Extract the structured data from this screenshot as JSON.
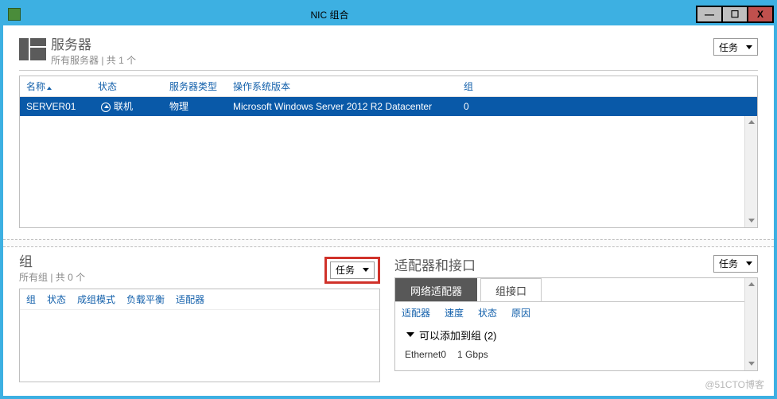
{
  "window": {
    "title": "NIC 组合",
    "min": "—",
    "max": "☐",
    "close": "X"
  },
  "servers": {
    "title": "服务器",
    "subtitle": "所有服务器 | 共 1 个",
    "task_label": "任务",
    "columns": {
      "name": "名称",
      "status": "状态",
      "type": "服务器类型",
      "os": "操作系统版本",
      "group": "组"
    },
    "row": {
      "name": "SERVER01",
      "status": "联机",
      "type": "物理",
      "os": "Microsoft Windows Server 2012 R2 Datacenter",
      "group": "0"
    }
  },
  "groups": {
    "title": "组",
    "subtitle": "所有组 | 共 0 个",
    "task_label": "任务",
    "columns": {
      "group": "组",
      "status": "状态",
      "mode": "成组模式",
      "lb": "负载平衡",
      "adapter": "适配器"
    }
  },
  "adapters": {
    "title": "适配器和接口",
    "task_label": "任务",
    "tab_net": "网络适配器",
    "tab_team": "组接口",
    "columns": {
      "adapter": "适配器",
      "speed": "速度",
      "status": "状态",
      "reason": "原因"
    },
    "add_group": "可以添加到组 (2)",
    "eth_name": "Ethernet0",
    "eth_speed": "1 Gbps"
  },
  "watermark": "@51CTO博客"
}
